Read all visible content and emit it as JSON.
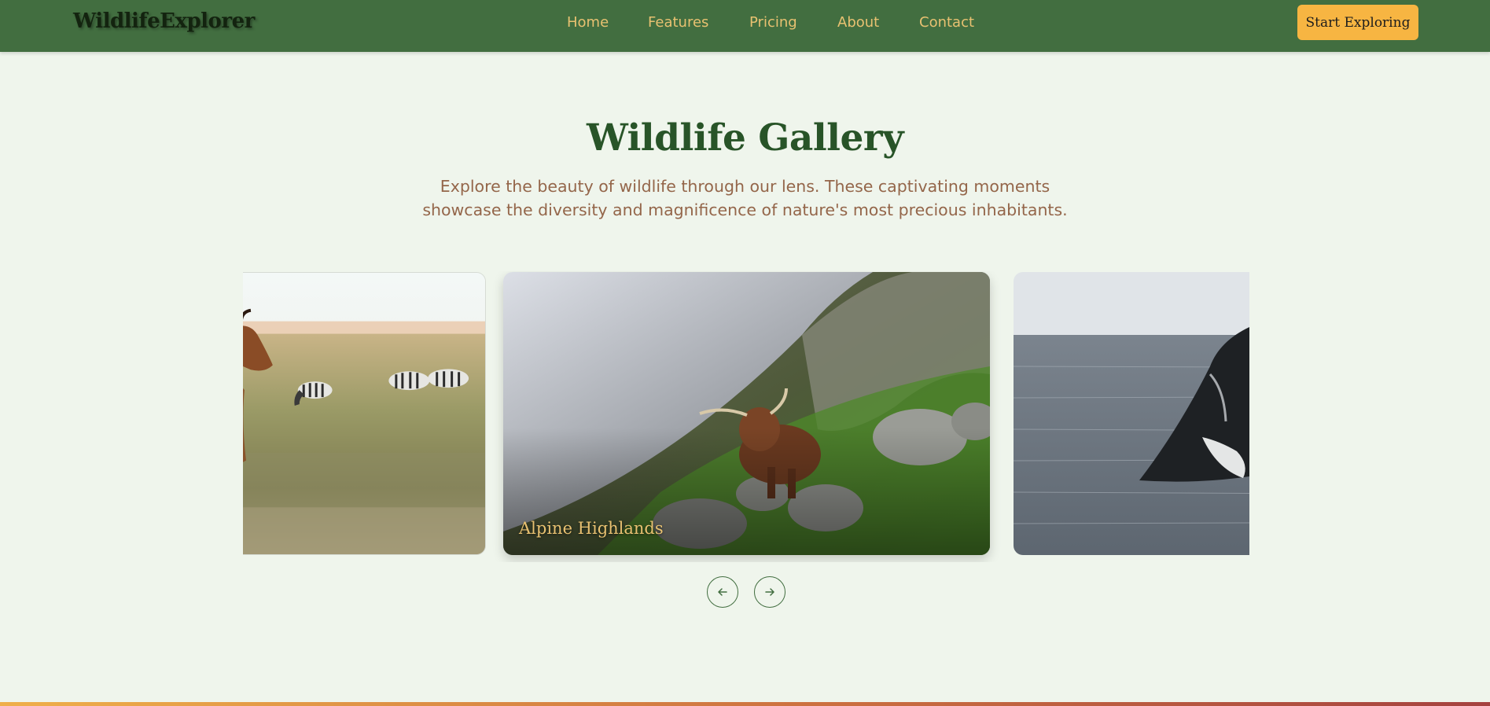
{
  "header": {
    "logo": "WildlifeExplorer",
    "nav": [
      {
        "label": "Home"
      },
      {
        "label": "Features"
      },
      {
        "label": "Pricing"
      },
      {
        "label": "About"
      },
      {
        "label": "Contact"
      }
    ],
    "cta_label": "Start Exploring"
  },
  "gallery": {
    "title": "Wildlife Gallery",
    "subtitle_line1": "Explore the beauty of wildlife through our lens. These captivating moments",
    "subtitle_line2": "showcase the diversity and magnificence of nature's most precious inhabitants.",
    "slides": [
      {
        "caption": ""
      },
      {
        "caption": "Alpine Highlands"
      },
      {
        "caption": ""
      }
    ],
    "prev_icon": "arrow-left-icon",
    "next_icon": "arrow-right-icon"
  },
  "colors": {
    "header_bg": "#426e40",
    "nav_text": "#e8c171",
    "cta_bg": "#f7b542",
    "page_bg": "#eff5ec",
    "title": "#285428",
    "subtitle": "#94664a"
  }
}
